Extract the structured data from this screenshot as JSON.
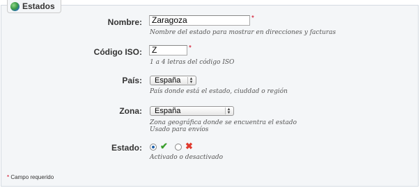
{
  "section": {
    "title": "Estados",
    "icon": "globe-icon"
  },
  "fields": {
    "name": {
      "label": "Nombre:",
      "value": "Zaragoza",
      "required_mark": "*",
      "hint": "Nombre del estado para mostrar en direcciones y facturas"
    },
    "iso": {
      "label": "Código ISO:",
      "value": "Z",
      "required_mark": "*",
      "hint": "1 a 4 letras del código ISO"
    },
    "country": {
      "label": "País:",
      "selected": "España",
      "hint": "País donde está el estado, ciuddad o región"
    },
    "zone": {
      "label": "Zona:",
      "selected": "España",
      "hint_line1": "Zona geográfica donde se encuentra el estado",
      "hint_line2": "Usado para envíos"
    },
    "status": {
      "label": "Estado:",
      "selected": "enabled",
      "hint": "Activado o desactivado"
    }
  },
  "footnote": {
    "star": "*",
    "text": " Campo requerido"
  },
  "colors": {
    "required": "#d0021b",
    "enabled_icon": "#3a9e2c",
    "disabled_icon": "#e03a2e",
    "panel_bg": "#f4f6f8"
  }
}
